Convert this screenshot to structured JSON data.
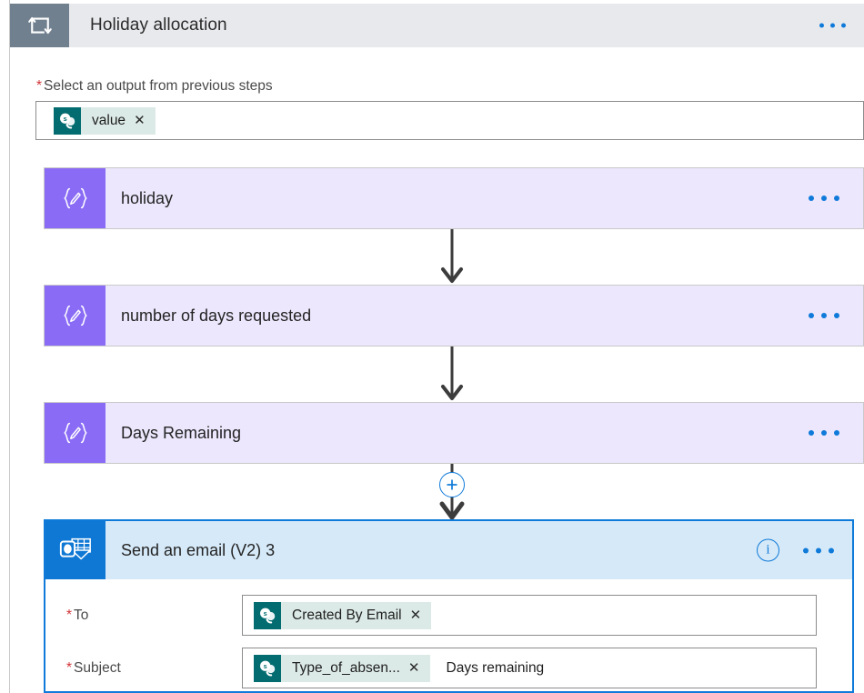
{
  "loop": {
    "icon": "loop-repeat-icon",
    "title": "Holiday allocation",
    "menu_label": "…"
  },
  "output_field": {
    "required_marker": "*",
    "label": "Select an output from previous steps",
    "token": {
      "icon": "sharepoint-icon",
      "text": "value",
      "remove_label": "✕"
    }
  },
  "cards": [
    {
      "id": "holiday",
      "icon": "compose-variable-icon",
      "title": "holiday",
      "menu_label": "…"
    },
    {
      "id": "number-of-days-requested",
      "icon": "compose-variable-icon",
      "title": "number of days requested",
      "menu_label": "…"
    },
    {
      "id": "days-remaining",
      "icon": "compose-variable-icon",
      "title": "Days Remaining",
      "menu_label": "…"
    }
  ],
  "add_step": {
    "icon": "plus-icon",
    "label": "+"
  },
  "email_action": {
    "icon": "outlook-icon",
    "title": "Send an email (V2) 3",
    "info_label": "i",
    "menu_label": "…",
    "fields": [
      {
        "id": "to",
        "required_marker": "*",
        "label": "To",
        "token": {
          "icon": "sharepoint-icon",
          "text": "Created By Email",
          "remove_label": "✕"
        },
        "extra_text": ""
      },
      {
        "id": "subject",
        "required_marker": "*",
        "label": "Subject",
        "token": {
          "icon": "sharepoint-icon",
          "text": "Type_of_absen...",
          "remove_label": "✕"
        },
        "extra_text": "Days remaining"
      }
    ]
  },
  "colors": {
    "accent_blue": "#0f7ad9",
    "outlook_blue": "#0f78d4",
    "variable_purple": "#8a6bf5",
    "variable_lavender": "#ece7fd",
    "sharepoint_teal": "#036c70",
    "loop_slate": "#71808f",
    "required_red": "#d13438",
    "email_header_blue": "#d6e9f8"
  }
}
